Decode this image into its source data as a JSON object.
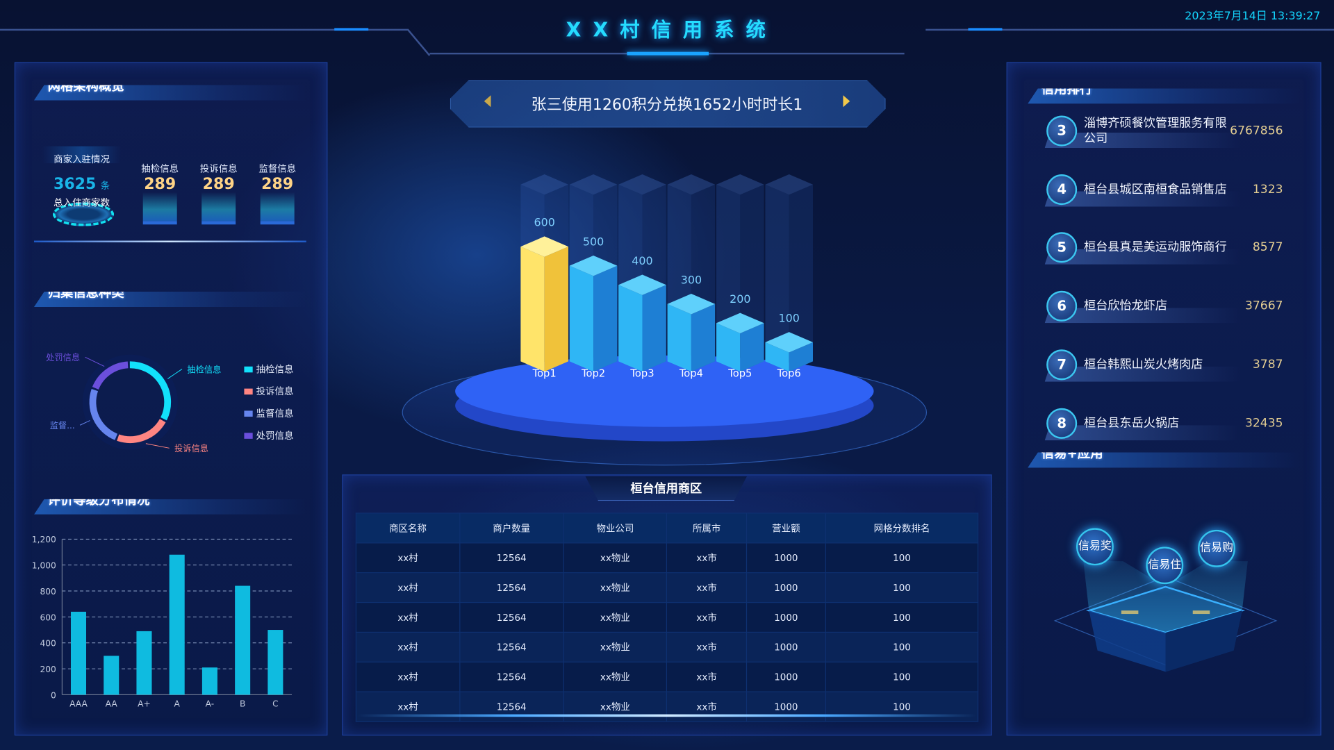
{
  "header": {
    "title": "X X 村 信 用 系 统",
    "datetime": "2023年7月14日 13:39:27"
  },
  "left": {
    "overview": {
      "title": "网格架构概览",
      "merchant_label": "商家入驻情况",
      "merchant_count": "3625",
      "merchant_unit": "条",
      "merchant_caption": "总入住商家数",
      "items": [
        {
          "label": "抽检信息",
          "value": "289"
        },
        {
          "label": "投诉信息",
          "value": "289"
        },
        {
          "label": "监督信息",
          "value": "289"
        }
      ]
    },
    "categories": {
      "title": "归集信息种类",
      "slices": [
        {
          "name": "抽检信息",
          "label": "抽检信息",
          "value": 32,
          "color": "#12e1fb"
        },
        {
          "name": "投诉信息",
          "label": "投诉信息",
          "value": 22,
          "color": "#ff8582"
        },
        {
          "name": "监督信息",
          "label": "监督...",
          "value": 24,
          "color": "#6685ee"
        },
        {
          "name": "处罚信息",
          "label": "处罚信息",
          "value": 18,
          "color": "#6b4fdc"
        }
      ]
    },
    "grades": {
      "title": "评价等级分布情况"
    }
  },
  "chart_data": [
    {
      "type": "bar",
      "categories": [
        "AAA",
        "AA",
        "A+",
        "A",
        "A-",
        "B",
        "C"
      ],
      "values": [
        640,
        300,
        490,
        1080,
        210,
        840,
        500
      ],
      "ylim": [
        0,
        1200
      ],
      "yticks": [
        "0",
        "200",
        "400",
        "600",
        "800",
        "1,000",
        "1,200"
      ],
      "grid": true,
      "color": "#0fbbe0"
    },
    {
      "type": "bar",
      "categories": [
        "Top1",
        "Top2",
        "Top3",
        "Top4",
        "Top5",
        "Top6"
      ],
      "values": [
        600,
        500,
        400,
        300,
        200,
        100
      ],
      "data_labels": [
        "600",
        "500",
        "400",
        "300",
        "200",
        "100"
      ],
      "colors": {
        "first": "#ffd84a",
        "rest": "#2aa7ec"
      }
    },
    {
      "type": "pie",
      "values": [
        32,
        22,
        24,
        18
      ],
      "categories": [
        "抽检信息",
        "投诉信息",
        "监督信息",
        "处罚信息"
      ],
      "legend": "right"
    }
  ],
  "center": {
    "ticker": "张三使用1260积分兑换1652小时时长1",
    "table": {
      "title": "桓台信用商区",
      "headers": [
        "商区名称",
        "商户数量",
        "物业公司",
        "所属市",
        "营业额",
        "网格分数排名"
      ],
      "rows": [
        [
          "xx村",
          "12564",
          "xx物业",
          "xx市",
          "1000",
          "100"
        ],
        [
          "xx村",
          "12564",
          "xx物业",
          "xx市",
          "1000",
          "100"
        ],
        [
          "xx村",
          "12564",
          "xx物业",
          "xx市",
          "1000",
          "100"
        ],
        [
          "xx村",
          "12564",
          "xx物业",
          "xx市",
          "1000",
          "100"
        ],
        [
          "xx村",
          "12564",
          "xx物业",
          "xx市",
          "1000",
          "100"
        ],
        [
          "xx村",
          "12564",
          "xx物业",
          "xx市",
          "1000",
          "100"
        ]
      ]
    }
  },
  "right": {
    "ranking": {
      "title": "信用排行",
      "items": [
        {
          "rank": "3",
          "name": "淄博齐硕餐饮管理服务有限公司",
          "value": "6767856"
        },
        {
          "rank": "4",
          "name": "桓台县城区南桓食品销售店",
          "value": "1323"
        },
        {
          "rank": "5",
          "name": "桓台县真是美运动服饰商行",
          "value": "8577"
        },
        {
          "rank": "6",
          "name": "桓台欣怡龙虾店",
          "value": "37667"
        },
        {
          "rank": "7",
          "name": "桓台韩熙山炭火烤肉店",
          "value": "3787"
        },
        {
          "rank": "8",
          "name": "桓台县东岳火锅店",
          "value": "32435"
        }
      ]
    },
    "apps": {
      "title": "信易+应用",
      "items": [
        "信易奖",
        "信易住",
        "信易购"
      ]
    }
  }
}
